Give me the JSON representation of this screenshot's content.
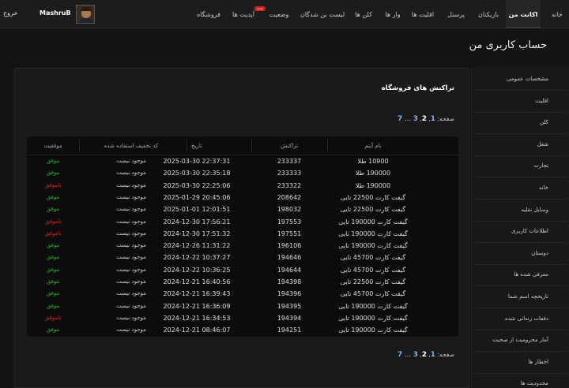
{
  "user": {
    "logout_label": "خروج",
    "username": "MashruB"
  },
  "nav": [
    {
      "label": "خانه",
      "active": false,
      "badge": ""
    },
    {
      "label": "اکانت من",
      "active": true,
      "badge": ""
    },
    {
      "label": "بازیکنان",
      "active": false,
      "badge": ""
    },
    {
      "label": "پرسنل",
      "active": false,
      "badge": ""
    },
    {
      "label": "اقلیت ها",
      "active": false,
      "badge": ""
    },
    {
      "label": "وار ها",
      "active": false,
      "badge": ""
    },
    {
      "label": "کلن ها",
      "active": false,
      "badge": ""
    },
    {
      "label": "لیست بن شدگان",
      "active": false,
      "badge": ""
    },
    {
      "label": "وضعیت",
      "active": false,
      "badge": ""
    },
    {
      "label": "آپدیت ها",
      "active": false,
      "badge": "جدید"
    },
    {
      "label": "فروشگاه",
      "active": false,
      "badge": ""
    }
  ],
  "page_title": "حساب کاربری من",
  "sidebar": [
    "مشخصات عمومی",
    "اقلیت",
    "کلن",
    "شغل",
    "تجارت",
    "خانه",
    "وسایل نقلیه",
    "اطلاعات کاربری",
    "دوستان",
    "معرفی شده ها",
    "تاریخچه اسم شما",
    "دفعات زندانی شده",
    "آمار محرومیت از صحبت",
    "اخطار ها",
    "محدودیت ها"
  ],
  "section_title": "تراکنش های فروشگاه",
  "pagination": {
    "label": "صفحه:",
    "pages": [
      "1",
      "2",
      "3",
      "...",
      "7"
    ],
    "current": "2"
  },
  "table": {
    "headers": [
      "نام آیتم",
      "تراکنش",
      "تاریخ",
      "کد تخفیف استفاده شده",
      "موفقیت"
    ],
    "rows": [
      [
        "10900 طلا",
        "233337",
        "2025-03-30 22:37:31",
        "موجود نیست",
        "موفق"
      ],
      [
        "190000 طلا",
        "233333",
        "2025-03-30 22:35:18",
        "موجود نیست",
        "موفق"
      ],
      [
        "190000 طلا",
        "233322",
        "2025-03-30 22:25:06",
        "موجود نیست",
        "ناموفق"
      ],
      [
        "گیفت کارت 22500 تایی",
        "208642",
        "2025-01-29 20:45:06",
        "موجود نیست",
        "موفق"
      ],
      [
        "گیفت کارت 22500 تایی",
        "198032",
        "2025-01-01 12:01:51",
        "موجود نیست",
        "موفق"
      ],
      [
        "گیفت کارت 190000 تایی",
        "197553",
        "2024-12-30 17:56:21",
        "موجود نیست",
        "ناموفق"
      ],
      [
        "گیفت کارت 190000 تایی",
        "197551",
        "2024-12-30 17:51:32",
        "موجود نیست",
        "ناموفق"
      ],
      [
        "گیفت کارت 190000 تایی",
        "196106",
        "2024-12-26 11:31:22",
        "موجود نیست",
        "موفق"
      ],
      [
        "گیفت کارت 45700 تایی",
        "194646",
        "2024-12-22 10:37:27",
        "موجود نیست",
        "موفق"
      ],
      [
        "گیفت کارت 45700 تایی",
        "194644",
        "2024-12-22 10:36:25",
        "موجود نیست",
        "موفق"
      ],
      [
        "گیفت کارت 22500 تایی",
        "194398",
        "2024-12-21 16:40:56",
        "موجود نیست",
        "موفق"
      ],
      [
        "گیفت کارت 45700 تایی",
        "194396",
        "2024-12-21 16:39:43",
        "موجود نیست",
        "موفق"
      ],
      [
        "گیفت کارت 190000 تایی",
        "194395",
        "2024-12-21 16:36:09",
        "موجود نیست",
        "موفق"
      ],
      [
        "گیفت کارت 190000 تایی",
        "194394",
        "2024-12-21 16:34:53",
        "موجود نیست",
        "ناموفق"
      ],
      [
        "گیفت کارت 190000 تایی",
        "194251",
        "2024-12-21 08:46:07",
        "موجود نیست",
        "موفق"
      ]
    ]
  },
  "colors": {
    "success": "#27b327",
    "failure": "#d92626",
    "link": "#7fb0e8",
    "badge": "#d8241c"
  }
}
